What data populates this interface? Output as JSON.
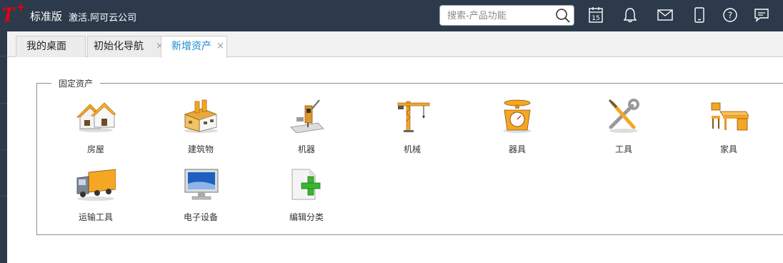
{
  "app": {
    "edition": "标准版",
    "activation": "激活.阿可云公司"
  },
  "search": {
    "placeholder": "搜索-产品功能"
  },
  "toolbar_icons": [
    "calendar-icon",
    "bell-icon",
    "mail-icon",
    "mobile-icon",
    "help-icon",
    "message-icon"
  ],
  "calendar_day": "15",
  "tabs": [
    {
      "label": "我的桌面",
      "closable": false,
      "active": false
    },
    {
      "label": "初始化导航",
      "closable": true,
      "active": false
    },
    {
      "label": "新增资产",
      "closable": true,
      "active": true
    }
  ],
  "close_glyph": "×",
  "section": {
    "title": "固定资产",
    "items": [
      {
        "label": "房屋",
        "icon": "house-icon"
      },
      {
        "label": "建筑物",
        "icon": "building-icon"
      },
      {
        "label": "机器",
        "icon": "machine-icon"
      },
      {
        "label": "机械",
        "icon": "crane-icon"
      },
      {
        "label": "器具",
        "icon": "scale-icon"
      },
      {
        "label": "工具",
        "icon": "tools-icon"
      },
      {
        "label": "家具",
        "icon": "furniture-icon"
      },
      {
        "label": "运输工具",
        "icon": "truck-icon"
      },
      {
        "label": "电子设备",
        "icon": "monitor-icon"
      },
      {
        "label": "编辑分类",
        "icon": "edit-category-icon"
      }
    ]
  },
  "colors": {
    "topbar": "#2c3a4b",
    "brand_red": "#e60012",
    "active_tab_text": "#1a8ad0",
    "icon_orange": "#f5a623"
  }
}
